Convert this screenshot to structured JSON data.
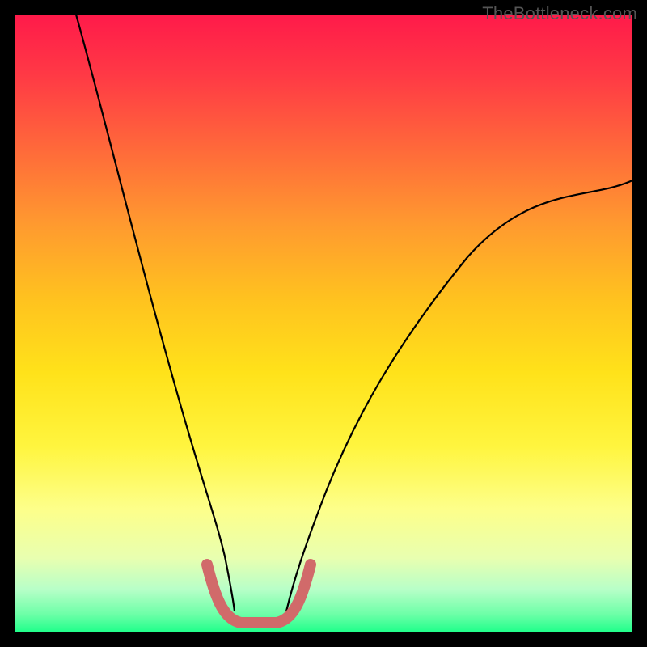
{
  "watermark": "TheBottleneck.com",
  "chart_data": {
    "type": "line",
    "title": "",
    "xlabel": "",
    "ylabel": "",
    "xlim": [
      0,
      100
    ],
    "ylim": [
      0,
      100
    ],
    "grid": false,
    "legend": false,
    "series": [
      {
        "name": "left-descending-curve",
        "color": "#000000",
        "x": [
          10,
          14,
          18,
          22,
          26,
          29,
          31,
          33,
          34.5
        ],
        "values": [
          100,
          80,
          61,
          44,
          29,
          18,
          11,
          6,
          3
        ]
      },
      {
        "name": "right-ascending-curve",
        "color": "#000000",
        "x": [
          44,
          47,
          51,
          56,
          62,
          70,
          80,
          90,
          100
        ],
        "values": [
          3,
          7,
          14,
          22,
          32,
          44,
          56,
          65,
          73
        ]
      },
      {
        "name": "bottom-u-shape",
        "color": "#d16a6a",
        "stroke_width": 12,
        "x": [
          31,
          33,
          35,
          37,
          39,
          41,
          43,
          45,
          47
        ],
        "values": [
          11,
          5,
          2,
          1,
          1,
          1,
          2,
          5,
          11
        ]
      }
    ],
    "background_gradient": {
      "direction": "vertical",
      "stops": [
        {
          "pos": 0,
          "color": "#ff1a4a"
        },
        {
          "pos": 50,
          "color": "#ffe21a"
        },
        {
          "pos": 100,
          "color": "#1eff8a"
        }
      ]
    }
  }
}
